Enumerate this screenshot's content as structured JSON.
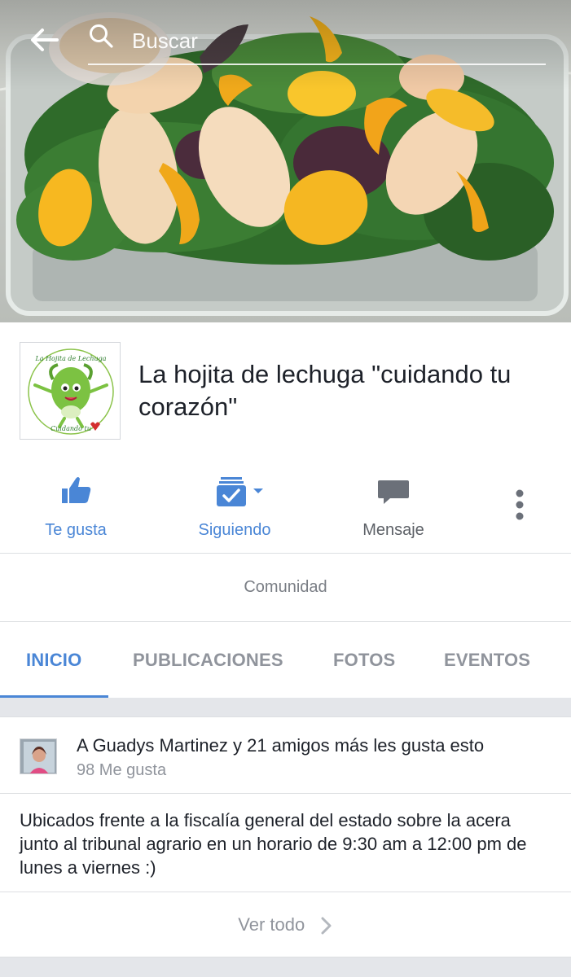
{
  "header": {
    "search_placeholder": "Buscar"
  },
  "page": {
    "title": "La hojita de lechuga \"cuidando tu corazón\"",
    "category": "Comunidad",
    "logo_text_top": "La Hojita de Lechuga",
    "logo_text_bottom": "Cuidando tu"
  },
  "actions": {
    "like_label": "Te gusta",
    "follow_label": "Siguiendo",
    "message_label": "Mensaje"
  },
  "tabs": [
    {
      "label": "INICIO",
      "active": true
    },
    {
      "label": "PUBLICACIONES",
      "active": false
    },
    {
      "label": "FOTOS",
      "active": false
    },
    {
      "label": "EVENTOS",
      "active": false
    }
  ],
  "about_card": {
    "likes_line": "A Guadys Martinez y 21 amigos más les gusta esto",
    "likes_count": "98 Me gusta",
    "description": "Ubicados frente a la fiscalía general del estado sobre la acera junto al tribunal agrario en un horario de 9:30 am a 12:00 pm de lunes a viernes :)",
    "see_all": "Ver todo"
  },
  "colors": {
    "accent": "#4a86d6",
    "text": "#1d2129",
    "muted": "#90949c"
  }
}
